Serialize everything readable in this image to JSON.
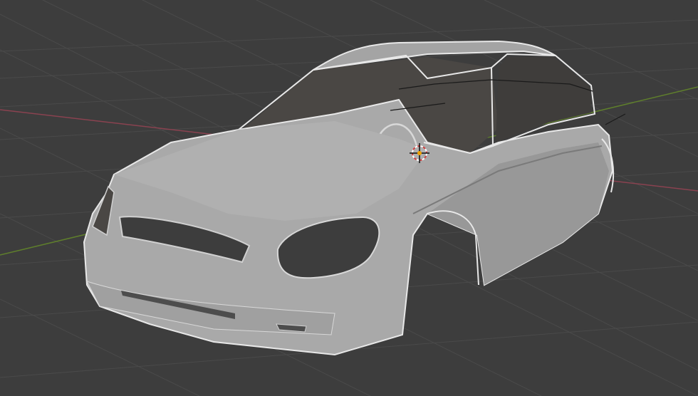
{
  "viewport": {
    "background_color": "#3d3d3d",
    "grid_color": "#4a4a4a",
    "x_axis_color": "#8a4250",
    "y_axis_color": "#5f7f2c",
    "mesh_fill_color": "#a9a9a9",
    "mesh_outline_color": "#e8e8e8",
    "interior_color": "#4a4744",
    "edge_color": "#1a1a1a",
    "cursor_icon": "3d-cursor-icon",
    "cursor_colors": [
      "#d04040",
      "#ffffff",
      "#f0a000"
    ]
  }
}
